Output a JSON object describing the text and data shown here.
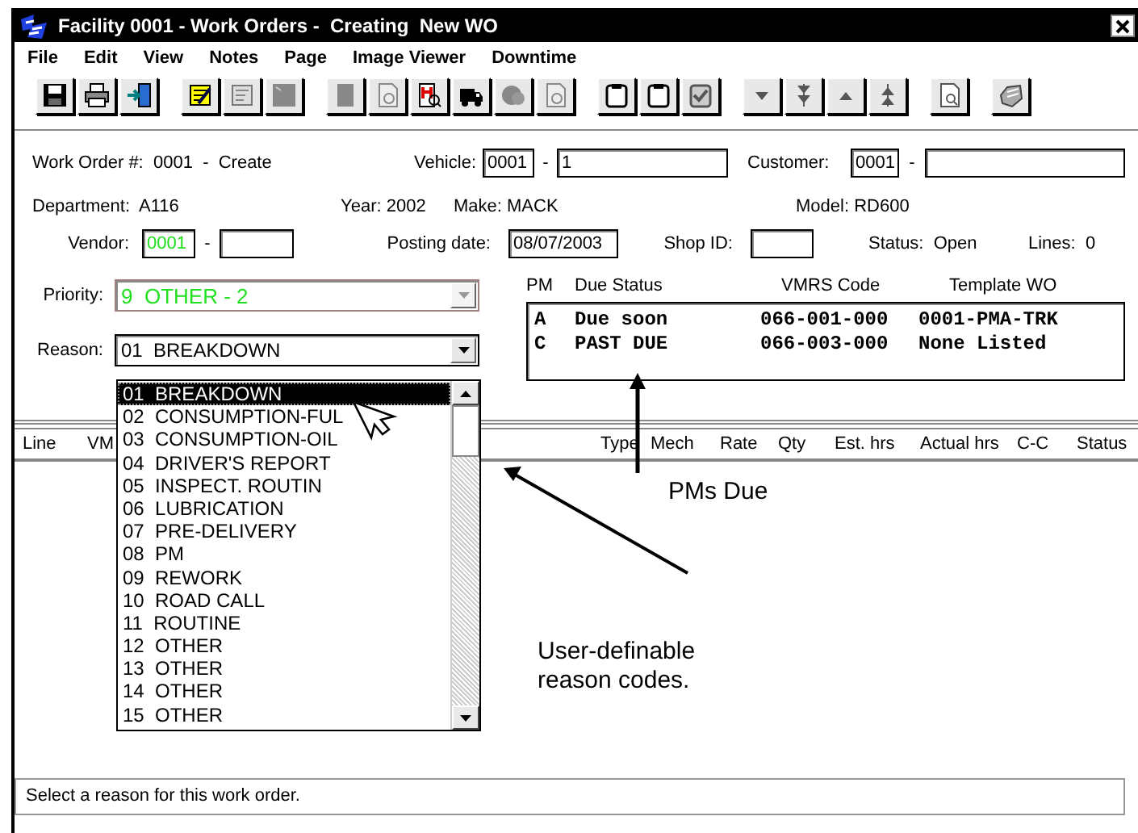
{
  "window": {
    "title": "Facility 0001 - Work Orders -  Creating  New WO"
  },
  "menu": [
    {
      "label": "File"
    },
    {
      "label": "Edit"
    },
    {
      "label": "View"
    },
    {
      "label": "Notes"
    },
    {
      "label": "Page"
    },
    {
      "label": "Image Viewer"
    },
    {
      "label": "Downtime"
    }
  ],
  "header": {
    "work_order": "Work Order #:  0001  -  Create",
    "vehicle": {
      "label": "Vehicle:",
      "code": "0001",
      "separator": "-",
      "number": "1"
    },
    "customer": {
      "label": "Customer:",
      "code": "0001",
      "separator": "-"
    },
    "department": "Department:  A116",
    "year": "Year: 2002",
    "make": "Make: MACK",
    "model": "Model: RD600",
    "vendor": {
      "label": "Vendor:",
      "code": "0001",
      "highlight": true,
      "separator": "-"
    },
    "posting_date": {
      "label": "Posting date:",
      "value": "08/07/2003"
    },
    "shop_id": {
      "label": "Shop ID:"
    },
    "status": "Status:  Open",
    "lines": "Lines:  0"
  },
  "priority": {
    "label": "Priority:",
    "value": "9  OTHER - 2",
    "highlight": true,
    "disabled": true
  },
  "reason": {
    "label": "Reason:",
    "value": "01  BREAKDOWN",
    "expanded": true,
    "options": [
      {
        "text": "01  BREAKDOWN",
        "selected": true
      },
      {
        "text": "02  CONSUMPTION-FUL",
        "selected": false
      },
      {
        "text": "03  CONSUMPTION-OIL",
        "selected": false
      },
      {
        "text": "04  DRIVER'S REPORT",
        "selected": false
      },
      {
        "text": "05  INSPECT. ROUTIN",
        "selected": false
      },
      {
        "text": "06  LUBRICATION",
        "selected": false
      },
      {
        "text": "07  PRE-DELIVERY",
        "selected": false
      },
      {
        "text": "08  PM",
        "selected": false
      },
      {
        "text": "09  REWORK",
        "selected": false
      },
      {
        "text": "10  ROAD CALL",
        "selected": false
      },
      {
        "text": "11  ROUTINE",
        "selected": false
      },
      {
        "text": "12  OTHER",
        "selected": false
      },
      {
        "text": "13  OTHER",
        "selected": false
      },
      {
        "text": "14  OTHER",
        "selected": false
      },
      {
        "text": "15  OTHER",
        "selected": false
      }
    ]
  },
  "pms": {
    "columns": [
      "PM",
      "Due Status",
      "VMRS Code",
      "Template WO"
    ],
    "rows": [
      [
        "A",
        "Due soon",
        "066-001-000",
        "0001-PMA-TRK"
      ],
      [
        "C",
        "PAST DUE",
        "066-003-000",
        "None Listed"
      ]
    ]
  },
  "lines_table": {
    "columns": [
      "Line",
      "VM",
      "Type",
      "Mech",
      "Rate",
      "Qty",
      "Est. hrs",
      "Actual hrs",
      "C-C",
      "Status"
    ]
  },
  "status_bar": "Select a reason for this work order.",
  "annotations": [
    {
      "text": "PMs Due"
    },
    {
      "text": "User-definable reason codes."
    }
  ]
}
